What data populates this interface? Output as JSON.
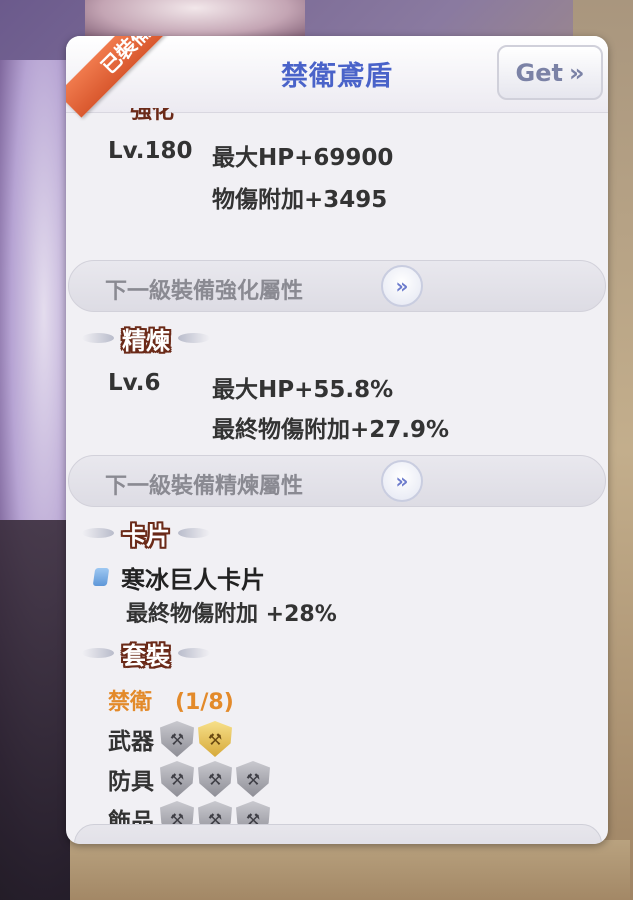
{
  "panel": {
    "title": "禁衛鳶盾",
    "equipped_label": "已裝備",
    "get_label": "Get",
    "get_icon": "double-chevron-right-icon"
  },
  "enhance": {
    "heading": "強化",
    "level": "Lv.180",
    "stats": [
      "最大HP+69900",
      "物傷附加+3495"
    ],
    "next_label": "下一級裝備強化屬性"
  },
  "refine": {
    "heading": "精煉",
    "level": "Lv.6",
    "stats": [
      "最大HP+55.8%",
      "最終物傷附加+27.9%"
    ],
    "next_label": "下一級裝備精煉屬性"
  },
  "card": {
    "heading": "卡片",
    "name": "寒冰巨人卡片",
    "effect": "最終物傷附加 +28%"
  },
  "set": {
    "heading": "套裝",
    "name": "禁衛",
    "progress": "(1/8)",
    "rows": [
      {
        "label": "武器",
        "owned": [
          false,
          true
        ]
      },
      {
        "label": "防具",
        "owned": [
          false,
          false,
          false
        ]
      },
      {
        "label": "飾品",
        "owned": [
          false,
          false,
          false
        ]
      }
    ]
  },
  "colors": {
    "title_blue": "#4a63c9",
    "ribbon_orange": "#e0663a",
    "set_orange": "#e38a2a",
    "heading_brown": "#6b2a18"
  }
}
